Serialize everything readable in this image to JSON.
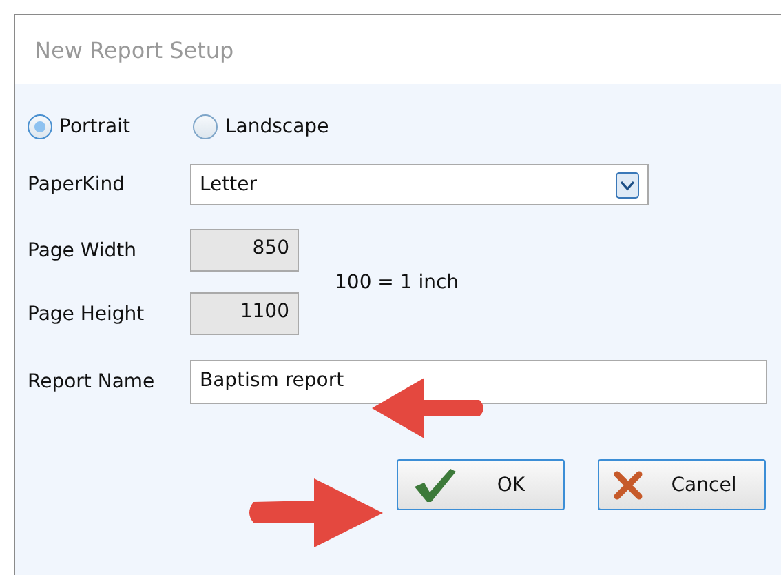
{
  "window": {
    "title": "New Report Setup"
  },
  "orientation": [
    {
      "label": "Portrait",
      "selected": true
    },
    {
      "label": "Landscape",
      "selected": false
    }
  ],
  "paper_kind": {
    "label": "PaperKind",
    "value": "Letter"
  },
  "page_width": {
    "label": "Page Width",
    "value": "850"
  },
  "page_height": {
    "label": "Page Height",
    "value": "1100"
  },
  "scale_note": "100 = 1 inch",
  "report_name": {
    "label": "Report Name",
    "value": "Baptism report"
  },
  "buttons": [
    {
      "kind": "ok",
      "label": "OK"
    },
    {
      "kind": "cancel",
      "label": "Cancel"
    }
  ]
}
